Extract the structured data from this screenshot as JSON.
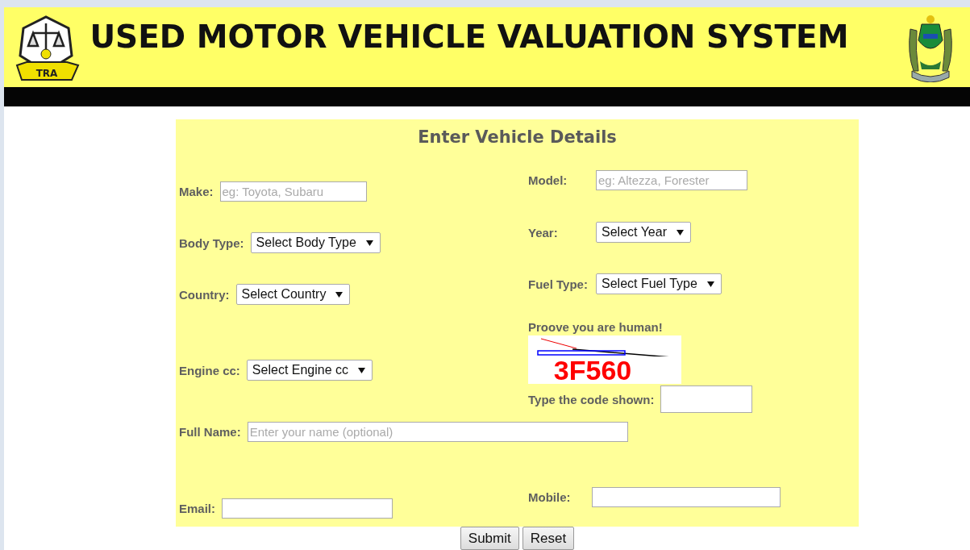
{
  "header": {
    "title": "USED MOTOR VEHICLE VALUATION SYSTEM",
    "logo_text": "TRA"
  },
  "form": {
    "title": "Enter Vehicle Details",
    "left": [
      {
        "kind": "input",
        "label": "Make:",
        "placeholder": "eg: Toyota, Subaru"
      },
      {
        "kind": "select",
        "label": "Body Type:",
        "value": "Select Body Type"
      },
      {
        "kind": "select",
        "label": "Country:",
        "value": "Select Country"
      },
      {
        "kind": "select",
        "label": "Engine cc:",
        "value": "Select Engine cc"
      }
    ],
    "right": [
      {
        "kind": "input",
        "label": "Model:",
        "placeholder": "eg: Altezza, Forester"
      },
      {
        "kind": "select",
        "label": "Year:",
        "value": "Select Year"
      },
      {
        "kind": "select",
        "label": "Fuel Type:",
        "value": "Select Fuel Type"
      },
      {
        "kind": "captcha",
        "label": "Proove you are human!",
        "code": "3F560",
        "input_label": "Type the code shown:"
      }
    ],
    "full_name": {
      "label": "Full Name:",
      "placeholder": "Enter your name (optional)"
    },
    "email": {
      "label": "Email:"
    },
    "mobile": {
      "label": "Mobile:"
    },
    "buttons": [
      "Submit",
      "Reset"
    ]
  }
}
